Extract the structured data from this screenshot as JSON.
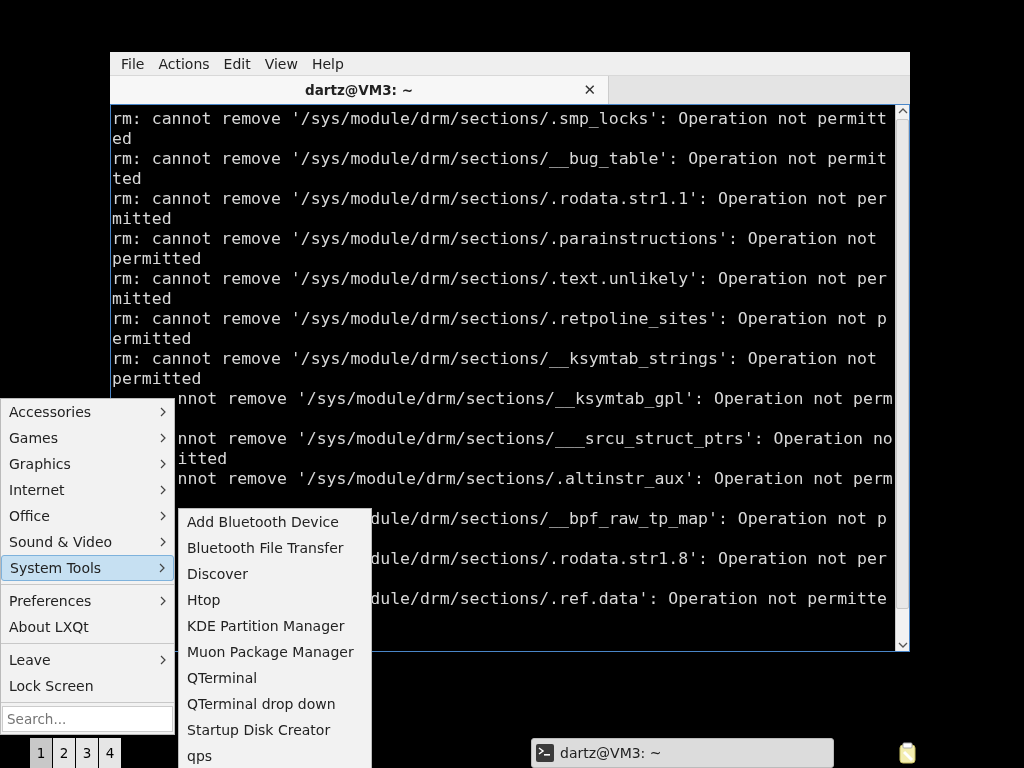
{
  "window": {
    "menu": [
      "File",
      "Actions",
      "Edit",
      "View",
      "Help"
    ],
    "tab": {
      "title": "dartz@VM3: ~",
      "close": "✕"
    },
    "terminal_lines": [
      {
        "text": "rm: cannot remove '/sys/module/drm/sections/.smp_locks': Operation not permitt"
      },
      {
        "text": "ed"
      },
      {
        "text": "rm: cannot remove '/sys/module/drm/sections/__bug_table': Operation not permit"
      },
      {
        "text": "ted"
      },
      {
        "text": "rm: cannot remove '/sys/module/drm/sections/.rodata.str1.1': Operation not per"
      },
      {
        "text": "mitted"
      },
      {
        "text": "rm: cannot remove '/sys/module/drm/sections/.parainstructions': Operation not"
      },
      {
        "text": "permitted"
      },
      {
        "text": "rm: cannot remove '/sys/module/drm/sections/.text.unlikely': Operation not per"
      },
      {
        "text": "mitted"
      },
      {
        "text": "rm: cannot remove '/sys/module/drm/sections/.retpoline_sites': Operation not p"
      },
      {
        "text": "ermitted"
      },
      {
        "text": "rm: cannot remove '/sys/module/drm/sections/__ksymtab_strings': Operation not"
      },
      {
        "text": "permitted"
      },
      {
        "text": "nnot remove '/sys/module/drm/sections/__ksymtab_gpl': Operation not perm",
        "kind": "behind_menu"
      },
      {
        "kind": "behind_menu"
      },
      {
        "text": "nnot remove '/sys/module/drm/sections/___srcu_struct_ptrs': Operation no",
        "kind": "behind_menu"
      },
      {
        "text": "itted",
        "kind": "behind_menu"
      },
      {
        "text": "nnot remove '/sys/module/drm/sections/.altinstr_aux': Operation not perm",
        "kind": "behind_menu"
      },
      {
        "kind": "behind_submenu"
      },
      {
        "text": "dule/drm/sections/__bpf_raw_tp_map': Operation not p",
        "kind": "behind_submenu"
      },
      {
        "kind": "behind_submenu"
      },
      {
        "text": "dule/drm/sections/.rodata.str1.8': Operation not per",
        "kind": "behind_submenu"
      },
      {
        "kind": "behind_submenu"
      },
      {
        "text": "dule/drm/sections/.ref.data': Operation not permitte",
        "kind": "behind_submenu"
      }
    ]
  },
  "start_menu": {
    "groups": [
      [
        {
          "label": "Accessories",
          "submenu": true,
          "selected": false
        },
        {
          "label": "Games",
          "submenu": true,
          "selected": false
        },
        {
          "label": "Graphics",
          "submenu": true,
          "selected": false
        },
        {
          "label": "Internet",
          "submenu": true,
          "selected": false
        },
        {
          "label": "Office",
          "submenu": true,
          "selected": false
        },
        {
          "label": "Sound & Video",
          "submenu": true,
          "selected": false
        },
        {
          "label": "System Tools",
          "submenu": true,
          "selected": true
        }
      ],
      [
        {
          "label": "Preferences",
          "submenu": true,
          "selected": false
        },
        {
          "label": "About LXQt",
          "submenu": false,
          "selected": false
        }
      ],
      [
        {
          "label": "Leave",
          "submenu": true,
          "selected": false
        },
        {
          "label": "Lock Screen",
          "submenu": false,
          "selected": false
        }
      ]
    ],
    "search": {
      "placeholder": "Search..."
    }
  },
  "submenu": {
    "items": [
      "Add Bluetooth Device",
      "Bluetooth File Transfer",
      "Discover",
      "Htop",
      "KDE Partition Manager",
      "Muon Package Manager",
      "QTerminal",
      "QTerminal drop down",
      "Startup Disk Creator",
      "qps"
    ]
  },
  "taskbar": {
    "desktops": [
      {
        "label": "1",
        "selected": true
      },
      {
        "label": "2",
        "selected": false
      },
      {
        "label": "3",
        "selected": false
      },
      {
        "label": "4",
        "selected": false
      }
    ],
    "task": {
      "title": "dartz@VM3: ~"
    }
  }
}
